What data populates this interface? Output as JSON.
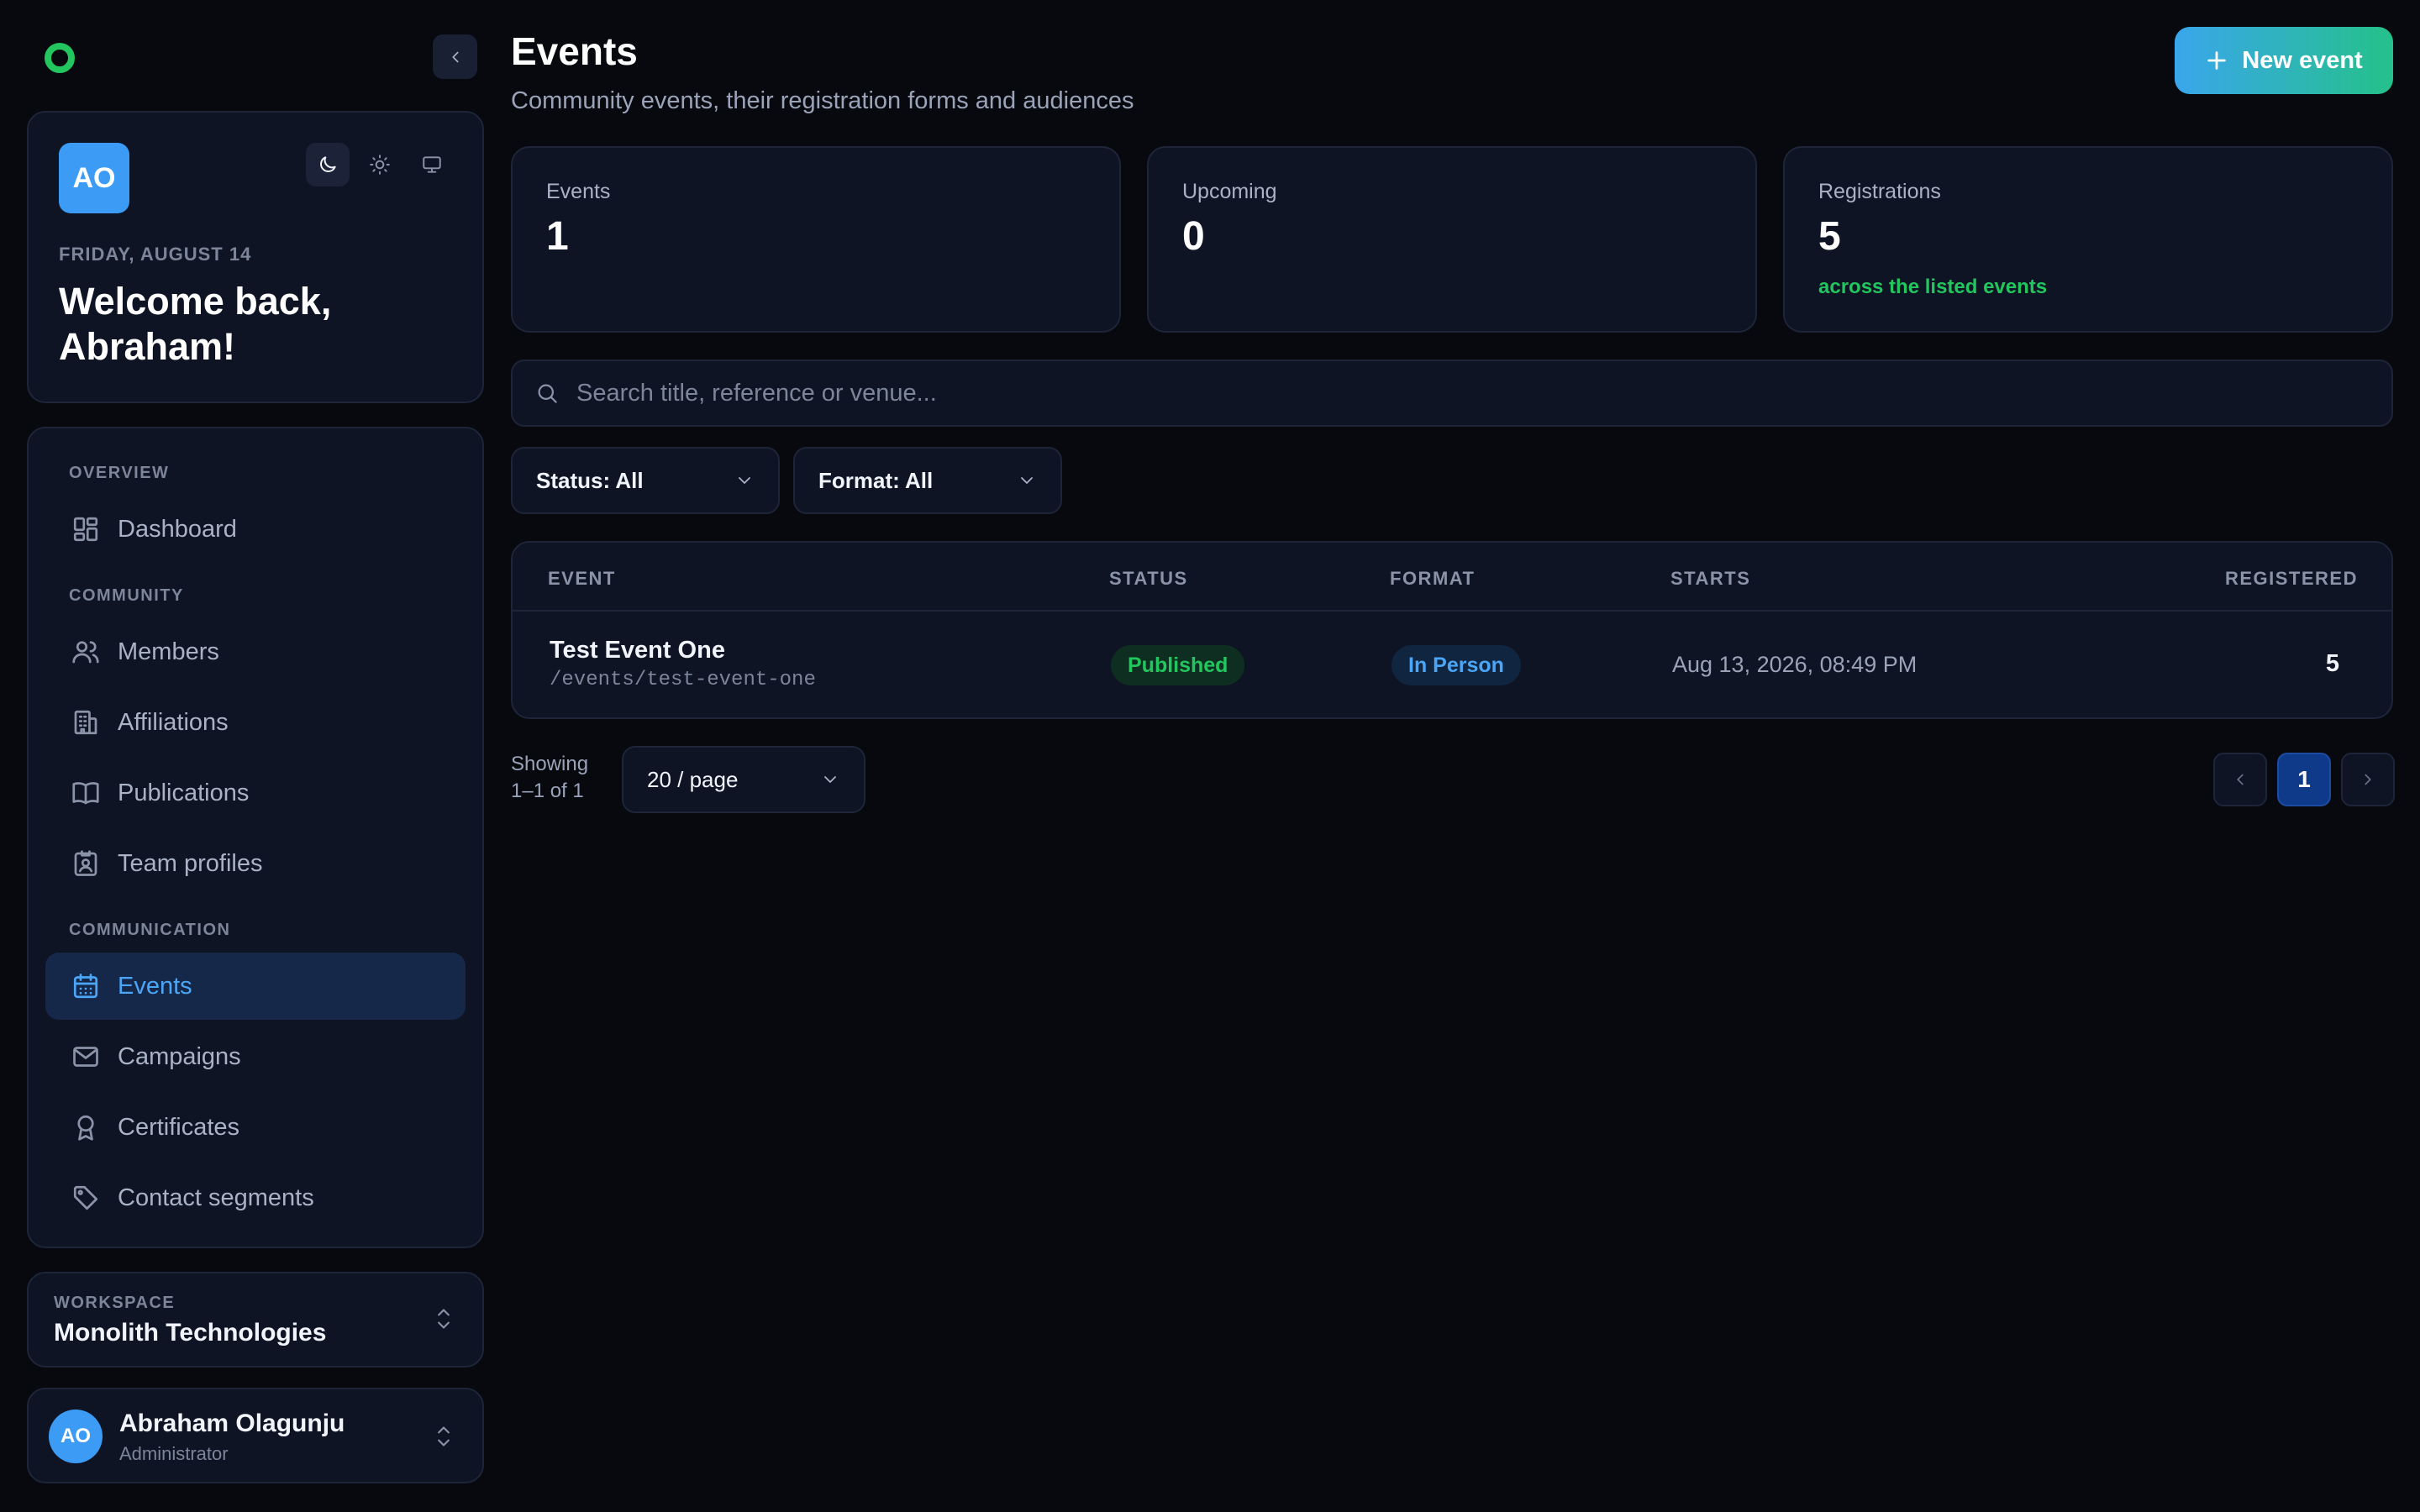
{
  "colors": {
    "background": "#07090f",
    "card": "#0f1424",
    "accent": "#4ba6f7",
    "success": "#22c55e",
    "gradient_start": "#3aa6ec",
    "gradient_end": "#25c18a"
  },
  "sidebar": {
    "collapse_icon": "chevron-left-icon",
    "welcome": {
      "avatar_initials": "AO",
      "date": "FRIDAY, AUGUST 14",
      "greeting": "Welcome back, Abraham!",
      "theme_options": [
        "moon-icon",
        "sun-icon",
        "monitor-icon"
      ]
    },
    "sections": [
      {
        "label": "OVERVIEW",
        "items": [
          {
            "label": "Dashboard",
            "icon": "dashboard-icon"
          }
        ]
      },
      {
        "label": "COMMUNITY",
        "items": [
          {
            "label": "Members",
            "icon": "users-icon"
          },
          {
            "label": "Affiliations",
            "icon": "building-icon"
          },
          {
            "label": "Publications",
            "icon": "book-icon"
          },
          {
            "label": "Team profiles",
            "icon": "id-badge-icon"
          }
        ]
      },
      {
        "label": "COMMUNICATION",
        "items": [
          {
            "label": "Events",
            "icon": "calendar-icon",
            "active": true
          },
          {
            "label": "Campaigns",
            "icon": "mail-icon"
          },
          {
            "label": "Certificates",
            "icon": "award-icon"
          },
          {
            "label": "Contact segments",
            "icon": "tag-icon"
          }
        ]
      }
    ],
    "workspace": {
      "label": "WORKSPACE",
      "name": "Monolith Technologies"
    },
    "user": {
      "initials": "AO",
      "name": "Abraham Olagunju",
      "role": "Administrator"
    }
  },
  "header": {
    "title": "Events",
    "subtitle": "Community events, their registration forms and audiences",
    "new_button_label": "New event"
  },
  "stats": [
    {
      "label": "Events",
      "value": "1",
      "note": ""
    },
    {
      "label": "Upcoming",
      "value": "0",
      "note": ""
    },
    {
      "label": "Registrations",
      "value": "5",
      "note": "across the listed events"
    }
  ],
  "search": {
    "placeholder": "Search title, reference or venue...",
    "value": ""
  },
  "filters": {
    "status": "Status: All",
    "format": "Format: All"
  },
  "table": {
    "columns": [
      "EVENT",
      "STATUS",
      "FORMAT",
      "STARTS",
      "REGISTERED"
    ],
    "rows": [
      {
        "title": "Test Event One",
        "path": "/events/test-event-one",
        "status": "Published",
        "format": "In Person",
        "starts": "Aug 13, 2026, 08:49 PM",
        "registered": "5"
      }
    ]
  },
  "pagination": {
    "showing": "Showing 1–1 of 1",
    "per_page": "20 / page",
    "current_page": "1"
  }
}
